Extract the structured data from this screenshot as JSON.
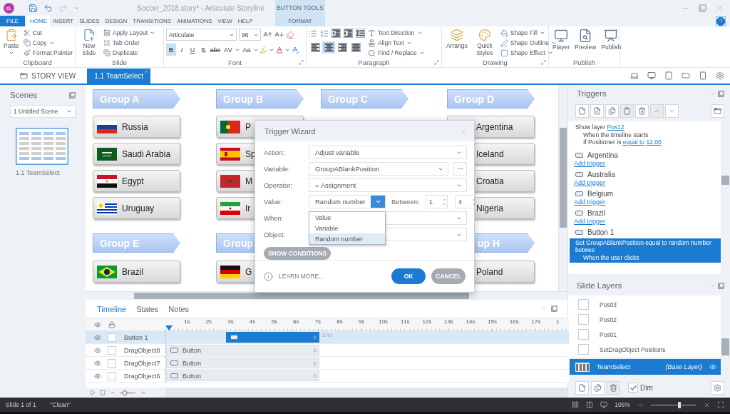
{
  "app": {
    "badge": "sL",
    "title": "Soccer_2018.story* - Articulate Storyline",
    "context_header": "BUTTON TOOLS"
  },
  "ribbon_tabs": [
    {
      "label": "FILE",
      "kind": "file",
      "selected": false
    },
    {
      "label": "HOME",
      "kind": "tab",
      "selected": true
    },
    {
      "label": "INSERT",
      "kind": "tab",
      "selected": false
    },
    {
      "label": "SLIDES",
      "kind": "tab",
      "selected": false
    },
    {
      "label": "DESIGN",
      "kind": "tab",
      "selected": false
    },
    {
      "label": "TRANSITIONS",
      "kind": "tab",
      "selected": false
    },
    {
      "label": "ANIMATIONS",
      "kind": "tab",
      "selected": false
    },
    {
      "label": "VIEW",
      "kind": "tab",
      "selected": false
    },
    {
      "label": "HELP",
      "kind": "tab",
      "selected": false
    },
    {
      "label": "FORMAT",
      "kind": "context",
      "selected": false
    }
  ],
  "clipboard": {
    "paste": "Paste",
    "items": [
      {
        "label": "Cut",
        "kind": "cut",
        "menu": false
      },
      {
        "label": "Copy",
        "kind": "copy",
        "menu": true
      },
      {
        "label": "Format Painter",
        "kind": "painter",
        "menu": false
      }
    ],
    "group": "Clipboard"
  },
  "slide_group": {
    "new_slide": "New Slide",
    "items": [
      {
        "label": "Apply Layout",
        "kind": "layout",
        "menu": true
      },
      {
        "label": "Tab Order",
        "kind": "order",
        "menu": false
      },
      {
        "label": "Duplicate",
        "kind": "duplicate",
        "menu": false
      }
    ],
    "group": "Slide"
  },
  "font": {
    "font_name": "Articulate",
    "font_size": "96",
    "styles": [
      {
        "label": "B",
        "kind": "bold",
        "selected": true
      },
      {
        "label": "I",
        "kind": "italic",
        "selected": false
      },
      {
        "label": "U",
        "kind": "underline",
        "selected": false
      },
      {
        "label": "S",
        "kind": "shadow",
        "selected": false
      },
      {
        "label": "abc",
        "kind": "strike",
        "selected": false
      }
    ],
    "spacing": "AV",
    "case": "Aa",
    "group": "Font"
  },
  "paragraph": {
    "alignments": [
      {
        "kind": "left",
        "selected": false
      },
      {
        "kind": "center",
        "selected": true
      },
      {
        "kind": "right",
        "selected": false
      },
      {
        "kind": "justify",
        "selected": false
      }
    ],
    "items": [
      {
        "label": "Text Direction",
        "kind": "direction"
      },
      {
        "label": "Align Text",
        "kind": "align"
      },
      {
        "label": "Find / Replace",
        "kind": "find"
      }
    ],
    "group": "Paragraph"
  },
  "drawing": {
    "big": [
      {
        "label": "Arrange",
        "kind": "arrange"
      },
      {
        "label": "Quick Styles",
        "kind": "styles"
      }
    ],
    "items": [
      {
        "label": "Shape Fill",
        "kind": "fill"
      },
      {
        "label": "Shape Outline",
        "kind": "outline"
      },
      {
        "label": "Shape Effect",
        "kind": "effect"
      }
    ],
    "group": "Drawing"
  },
  "publish": {
    "items": [
      {
        "label": "Player",
        "kind": "player"
      },
      {
        "label": "Preview",
        "kind": "preview"
      },
      {
        "label": "Publish",
        "kind": "publish"
      }
    ],
    "group": "Publish"
  },
  "doc_tabs": [
    {
      "label": "STORY VIEW",
      "kind": "story",
      "selected": false
    },
    {
      "label": "1.1 TeamSelect",
      "kind": "slide",
      "selected": true
    }
  ],
  "scenes": {
    "title": "Scenes",
    "scene": "1 Untitled Scene",
    "slide_label": "1.1 TeamSelect"
  },
  "slide": {
    "columns": [
      {
        "groups": [
          {
            "header": "Group A",
            "clipped": false,
            "teams": [
              {
                "name": "Russia",
                "kind": "russia"
              },
              {
                "name": "Saudi Arabia",
                "kind": "saudi"
              },
              {
                "name": "Egypt",
                "kind": "egypt"
              },
              {
                "name": "Uruguay",
                "kind": "uruguay"
              }
            ]
          },
          {
            "header": "Group E",
            "clipped": false,
            "teams": [
              {
                "name": "Brazil",
                "kind": "brazil"
              }
            ]
          }
        ]
      },
      {
        "groups": [
          {
            "header": "Group B",
            "clipped": false,
            "teams": [
              {
                "name": "P",
                "kind": "portugal"
              },
              {
                "name": "Sp",
                "kind": "spain"
              },
              {
                "name": "M",
                "kind": "morocco"
              },
              {
                "name": "Ir",
                "kind": "iran"
              }
            ]
          },
          {
            "header": "Group",
            "clipped": false,
            "teams": [
              {
                "name": "G",
                "kind": "germany"
              }
            ]
          }
        ]
      },
      {
        "groups": [
          {
            "header": "Group C",
            "clipped": false
          }
        ]
      },
      {
        "groups": [
          {
            "header": "Group D",
            "clipped": false,
            "teams": [
              {
                "name": "Argentina"
              },
              {
                "name": "Iceland"
              },
              {
                "name": "Croatia"
              },
              {
                "name": "Nigeria"
              }
            ]
          },
          {
            "header": "up H",
            "clipped": true,
            "teams": [
              {
                "name": "Poland"
              }
            ]
          }
        ]
      }
    ]
  },
  "dialog": {
    "title": "Trigger Wizard",
    "fields": [
      {
        "label": "Action:",
        "kind": "select",
        "value": "Adjust variable"
      },
      {
        "label": "Variable:",
        "kind": "select-more",
        "value": "GroupABlankPosition"
      },
      {
        "label": "Operator:",
        "kind": "select",
        "value": "= Assignment"
      },
      {
        "label": "Value:",
        "kind": "value",
        "value": "Random number",
        "between": "Between:",
        "from": "1",
        "to": "4"
      },
      {
        "label": "When:",
        "kind": "select"
      },
      {
        "label": "Object:",
        "kind": "select"
      }
    ],
    "options": [
      {
        "label": "Value",
        "selected": false
      },
      {
        "label": "Variable",
        "selected": false
      },
      {
        "label": "Random number",
        "selected": true
      }
    ],
    "show_conditions": "SHOW CONDITIONS",
    "learn_more": "LEARN MORE...",
    "ok": "OK",
    "cancel": "CANCEL"
  },
  "timeline": {
    "tabs": [
      {
        "label": "Timeline",
        "selected": true
      },
      {
        "label": "States",
        "selected": false
      },
      {
        "label": "Notes",
        "selected": false
      }
    ],
    "ruler": [
      "1s",
      "2s",
      "3s",
      "4s",
      "5s",
      "6s",
      "7s",
      "8s",
      "9s",
      "10s",
      "11s",
      "12s",
      "13s",
      "14s",
      "15s",
      "16s",
      "17s",
      "1"
    ],
    "rows": [
      {
        "name": "Button 1",
        "selected": true,
        "kind": "shape",
        "end": "End"
      },
      {
        "name": "DragObject8",
        "selected": false,
        "kind": "button",
        "bar": "Button"
      },
      {
        "name": "DragObject7",
        "selected": false,
        "kind": "button",
        "bar": "Button"
      },
      {
        "name": "DragObject6",
        "selected": false,
        "kind": "button",
        "bar": "Button"
      }
    ],
    "zoom": {
      "level": 0.3
    }
  },
  "triggers": {
    "title": "Triggers",
    "entries": [
      {
        "kind": "action",
        "selected": false,
        "parts": [
          {
            "kind": "text",
            "text": "Show layer"
          },
          {
            "kind": "link",
            "text": "Pos12"
          }
        ],
        "children": [
          {
            "parts": [
              {
                "kind": "text",
                "text": "When the timeline starts"
              }
            ]
          },
          {
            "parts": [
              {
                "kind": "text",
                "text": "If Positioner is"
              },
              {
                "kind": "link",
                "text": "equal to"
              },
              {
                "kind": "link",
                "text": "12.00"
              }
            ]
          }
        ]
      },
      {
        "kind": "object",
        "name": "Argentina",
        "add": "Add trigger"
      },
      {
        "kind": "object",
        "name": "Australia",
        "add": "Add trigger"
      },
      {
        "kind": "object",
        "name": "Belgium",
        "add": "Add trigger"
      },
      {
        "kind": "object",
        "name": "Brazil",
        "add": "Add trigger"
      },
      {
        "kind": "object",
        "name": "Button 1"
      },
      {
        "kind": "action",
        "selected": true,
        "parts": [
          {
            "kind": "text",
            "text": "Set GroupABlankPosition equal to random number betwee"
          }
        ],
        "children": [
          {
            "parts": [
              {
                "kind": "text",
                "text": "When the user clicks"
              }
            ]
          }
        ]
      }
    ]
  },
  "layers": {
    "title": "Slide Layers",
    "items": [
      {
        "name": "Pos03",
        "checked": false
      },
      {
        "name": "Pos02",
        "checked": false
      },
      {
        "name": "Pos01",
        "checked": false
      },
      {
        "name": "SetDragObject Positions",
        "checked": false
      }
    ],
    "base": {
      "name": "TeamSelect",
      "note": "(Base Layer)",
      "selected": true
    },
    "dim": {
      "label": "Dim",
      "checked": true
    }
  },
  "status": {
    "slide": "Slide 1 of 1",
    "theme": "\"Clean\"",
    "zoom": "106%",
    "level": 0.62
  }
}
